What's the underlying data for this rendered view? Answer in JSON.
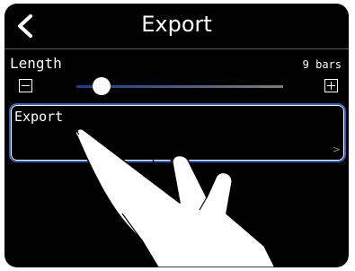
{
  "header": {
    "title": "Export",
    "back_icon": "chevron-left-icon"
  },
  "length_setting": {
    "label": "Length",
    "value": "9 bars",
    "minus_icon": "minus-box-icon",
    "plus_icon": "plus-box-icon",
    "slider_fraction": 0.12
  },
  "export_item": {
    "label": "Export",
    "chevron": ">"
  },
  "colors": {
    "background": "#000000",
    "selection_border": "#3a5db8",
    "text": "#ffffff"
  },
  "gesture": {
    "icon": "tapping-hand-icon"
  }
}
